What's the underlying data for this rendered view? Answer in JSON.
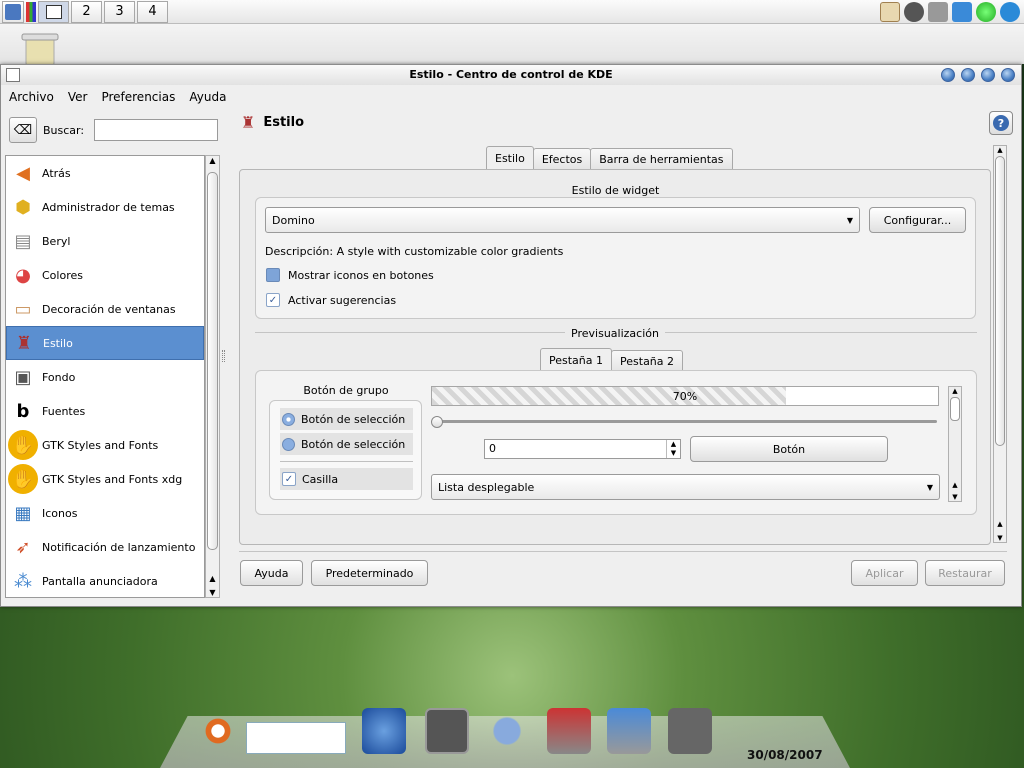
{
  "panel": {
    "desktops": [
      "2",
      "3",
      "4"
    ]
  },
  "window": {
    "title": "Estilo - Centro de control de KDE"
  },
  "menu": [
    "Archivo",
    "Ver",
    "Preferencias",
    "Ayuda"
  ],
  "search": {
    "label": "Buscar:",
    "value": ""
  },
  "sidebar": {
    "items": [
      {
        "label": "Atrás",
        "icon": "back-arrow-icon"
      },
      {
        "label": "Administrador de temas",
        "icon": "theme-manager-icon"
      },
      {
        "label": "Beryl",
        "icon": "beryl-icon"
      },
      {
        "label": "Colores",
        "icon": "colors-icon"
      },
      {
        "label": "Decoración de ventanas",
        "icon": "window-decoration-icon"
      },
      {
        "label": "Estilo",
        "icon": "style-icon"
      },
      {
        "label": "Fondo",
        "icon": "background-icon"
      },
      {
        "label": "Fuentes",
        "icon": "fonts-icon"
      },
      {
        "label": "GTK Styles and Fonts",
        "icon": "gnome-foot-icon"
      },
      {
        "label": "GTK Styles and Fonts xdg",
        "icon": "gnome-foot-icon"
      },
      {
        "label": "Iconos",
        "icon": "icons-icon"
      },
      {
        "label": "Notificación de lanzamiento",
        "icon": "launch-rocket-icon"
      },
      {
        "label": "Pantalla anunciadora",
        "icon": "splash-screen-icon"
      }
    ],
    "selected": "Estilo"
  },
  "content": {
    "title": "Estilo",
    "tabs": [
      "Estilo",
      "Efectos",
      "Barra de herramientas"
    ],
    "active_tab": "Estilo",
    "widget_style": {
      "title": "Estilo de widget",
      "selected": "Domino",
      "configure_label": "Configurar...",
      "description": "Descripción: A style with customizable color gradients",
      "checkbox_icons": {
        "label": "Mostrar iconos en botones",
        "checked": false
      },
      "checkbox_tips": {
        "label": "Activar sugerencias",
        "checked": true
      }
    },
    "preview": {
      "title": "Previsualización",
      "tabs": [
        "Pestaña 1",
        "Pestaña 2"
      ],
      "group_title": "Botón de grupo",
      "radio1": "Botón de selección",
      "radio2": "Botón de selección",
      "checkbox": "Casilla",
      "progress_text": "70%",
      "progress": 0.7,
      "spin_value": "0",
      "button": "Botón",
      "dropdown": "Lista desplegable"
    }
  },
  "buttons": {
    "help": "Ayuda",
    "defaults": "Predeterminado",
    "apply": "Aplicar",
    "reset": "Restaurar"
  },
  "taskbar": {
    "date": "30/08/2007"
  },
  "colors": {
    "selection": "#5b8fd0",
    "window_bg": "#efefef"
  }
}
